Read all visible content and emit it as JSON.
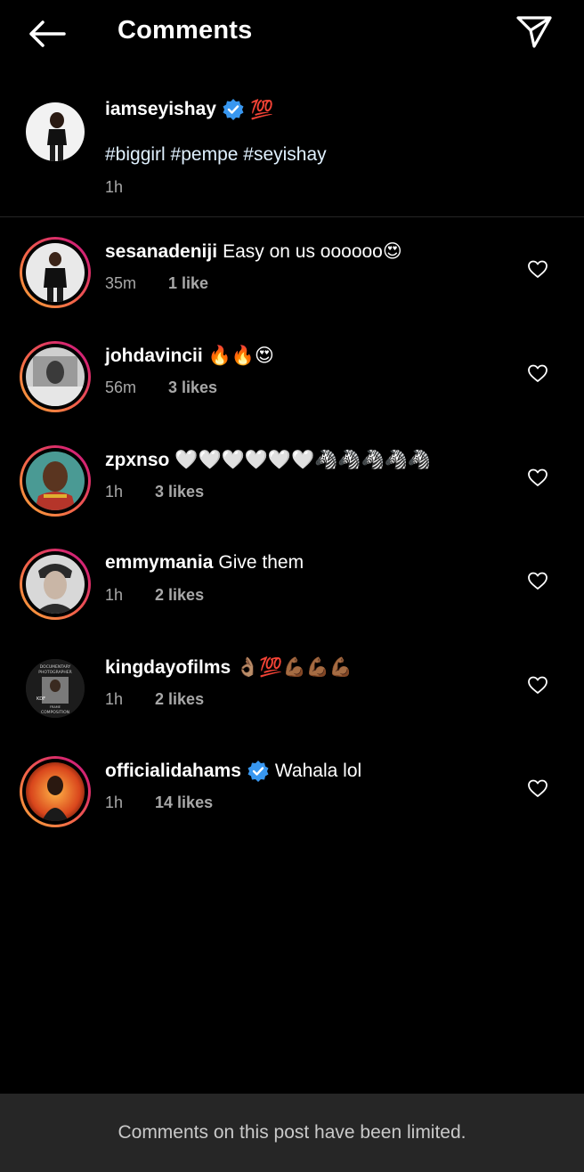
{
  "header": {
    "title": "Comments"
  },
  "caption": {
    "username": "iamseyishay",
    "emoji": "💯",
    "tags": "#biggirl #pempe #seyishay",
    "time": "1h"
  },
  "comments": [
    {
      "username": "sesanadeniji",
      "text": "Easy on us oooooo😍",
      "time": "35m",
      "likes": "1 like"
    },
    {
      "username": "johdavincii",
      "text": "🔥🔥😍",
      "time": "56m",
      "likes": "3 likes"
    },
    {
      "username": "zpxnso",
      "text": "🤍🤍🤍🤍🤍🤍🦓🦓🦓🦓🦓",
      "time": "1h",
      "likes": "3 likes"
    },
    {
      "username": "emmymania",
      "text": "Give them",
      "time": "1h",
      "likes": "2 likes"
    },
    {
      "username": "kingdayofilms",
      "text": "👌🏽💯💪🏾💪🏾💪🏾",
      "time": "1h",
      "likes": "2 likes"
    },
    {
      "username": "officialidahams",
      "text": "Wahala lol",
      "time": "1h",
      "likes": "14 likes"
    }
  ],
  "footer": {
    "notice": "Comments on this post have been limited."
  },
  "avatar_text": {
    "kingdayofilms": [
      "DOCUMENTARY",
      "PHOTOGRAPHER",
      "KDF",
      "FRAME",
      "COMPOSITION"
    ]
  },
  "colors": {
    "background": "#000000",
    "verified": "#3897f0",
    "secondary_text": "#a8a8a8",
    "footer_bg": "#262626"
  },
  "icons": {
    "back": "arrow-left-icon",
    "share": "paper-plane-icon",
    "verified": "verified-badge-icon",
    "like": "heart-outline-icon"
  }
}
